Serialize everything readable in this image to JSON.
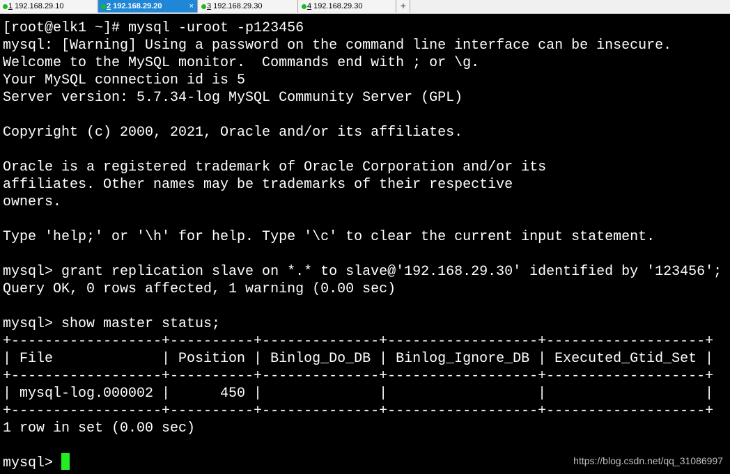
{
  "tabs": [
    {
      "num": "1",
      "host": "192.168.29.10",
      "status_color": "#1fb81f"
    },
    {
      "num": "2",
      "host": "192.168.29.20",
      "status_color": "#1fb81f",
      "active": true
    },
    {
      "num": "3",
      "host": "192.168.29.30",
      "status_color": "#1fb81f"
    },
    {
      "num": "4",
      "host": "192.168.29.30",
      "status_color": "#1fb81f"
    }
  ],
  "tab_close_glyph": "×",
  "new_tab_glyph": "+",
  "terminal": {
    "lines": [
      "[root@elk1 ~]# mysql -uroot -p123456",
      "mysql: [Warning] Using a password on the command line interface can be insecure.",
      "Welcome to the MySQL monitor.  Commands end with ; or \\g.",
      "Your MySQL connection id is 5",
      "Server version: 5.7.34-log MySQL Community Server (GPL)",
      "",
      "Copyright (c) 2000, 2021, Oracle and/or its affiliates.",
      "",
      "Oracle is a registered trademark of Oracle Corporation and/or its",
      "affiliates. Other names may be trademarks of their respective",
      "owners.",
      "",
      "Type 'help;' or '\\h' for help. Type '\\c' to clear the current input statement.",
      "",
      "mysql> grant replication slave on *.* to slave@'192.168.29.30' identified by '123456';",
      "Query OK, 0 rows affected, 1 warning (0.00 sec)",
      "",
      "mysql> show master status;",
      "+------------------+----------+--------------+------------------+-------------------+",
      "| File             | Position | Binlog_Do_DB | Binlog_Ignore_DB | Executed_Gtid_Set |",
      "+------------------+----------+--------------+------------------+-------------------+",
      "| mysql-log.000002 |      450 |              |                  |                   |",
      "+------------------+----------+--------------+------------------+-------------------+",
      "1 row in set (0.00 sec)",
      "",
      "mysql> "
    ],
    "cursor_color": "#22ee22"
  },
  "watermark": "https://blog.csdn.net/qq_31086997"
}
